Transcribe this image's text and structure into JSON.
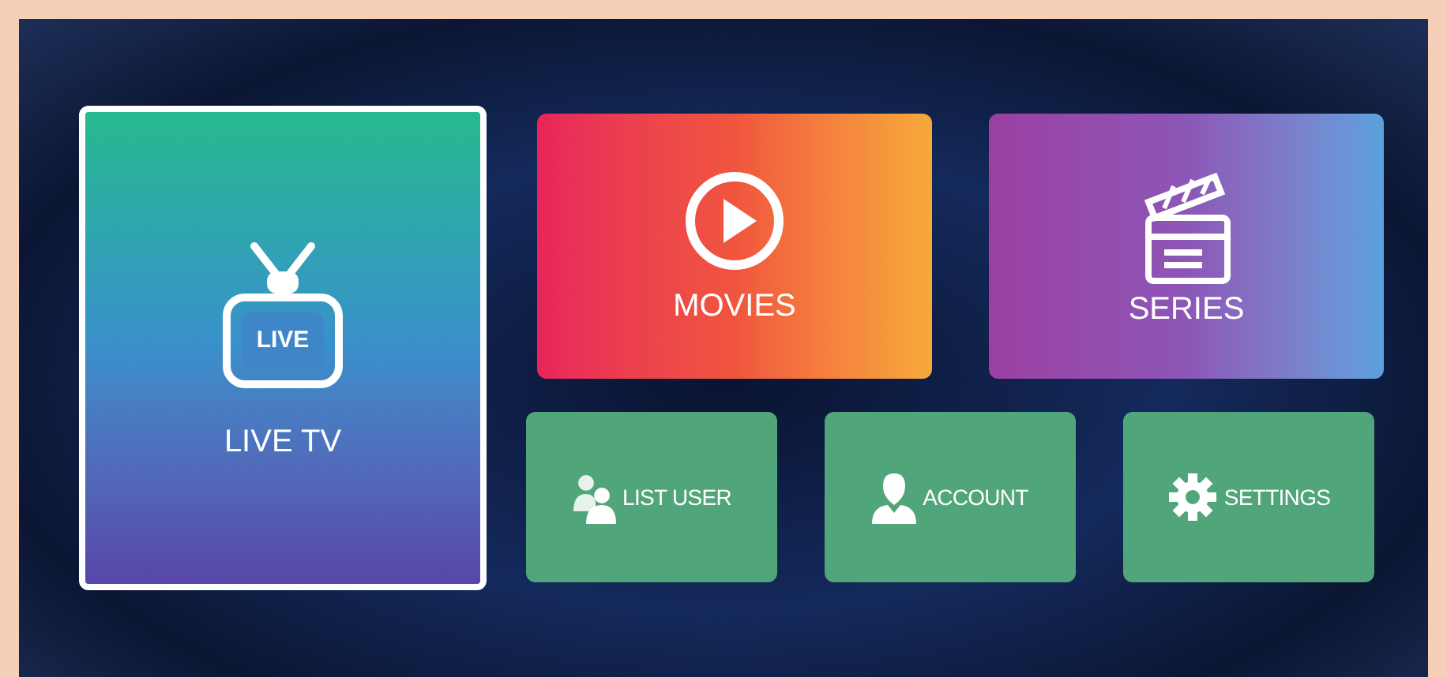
{
  "tiles": [
    {
      "kind": "tv",
      "label": "LIVE TV",
      "icon_text": "LIVE",
      "selected": true
    },
    {
      "kind": "movies",
      "label": "MOVIES",
      "selected": false
    },
    {
      "kind": "series",
      "label": "SERIES",
      "selected": false
    },
    {
      "kind": "users",
      "label": "LIST USER",
      "selected": false
    },
    {
      "kind": "account",
      "label": "ACCOUNT",
      "selected": false
    },
    {
      "kind": "settings",
      "label": "SETTINGS",
      "selected": false
    }
  ]
}
